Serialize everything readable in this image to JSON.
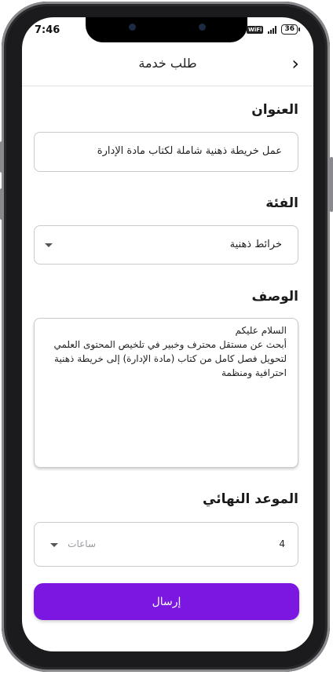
{
  "status_bar": {
    "time": "7:46",
    "wifi_label": "WiFi",
    "battery": "36"
  },
  "app_bar": {
    "title": "طلب خدمة",
    "back_icon": "chevron-right-icon"
  },
  "form": {
    "title_label": "العنوان",
    "title_value": "عمل خريطة ذهنية شاملة لكتاب مادة الإدارة",
    "category_label": "الفئة",
    "category_value": "خرائط ذهنية",
    "description_label": "الوصف",
    "description_value": "السلام عليكم\nأبحث عن مستقل محترف وخبير في تلخيص المحتوى العلمي لتحويل فصل كامل من كتاب (مادة الإدارة) إلى خريطة ذهنية احترافية ومنظمة",
    "deadline_label": "الموعد النهائي",
    "deadline_value": "4",
    "deadline_unit": "ساعات",
    "submit_label": "إرسال"
  },
  "colors": {
    "accent": "#7b17e0",
    "field_border": "#c9c9cf"
  }
}
